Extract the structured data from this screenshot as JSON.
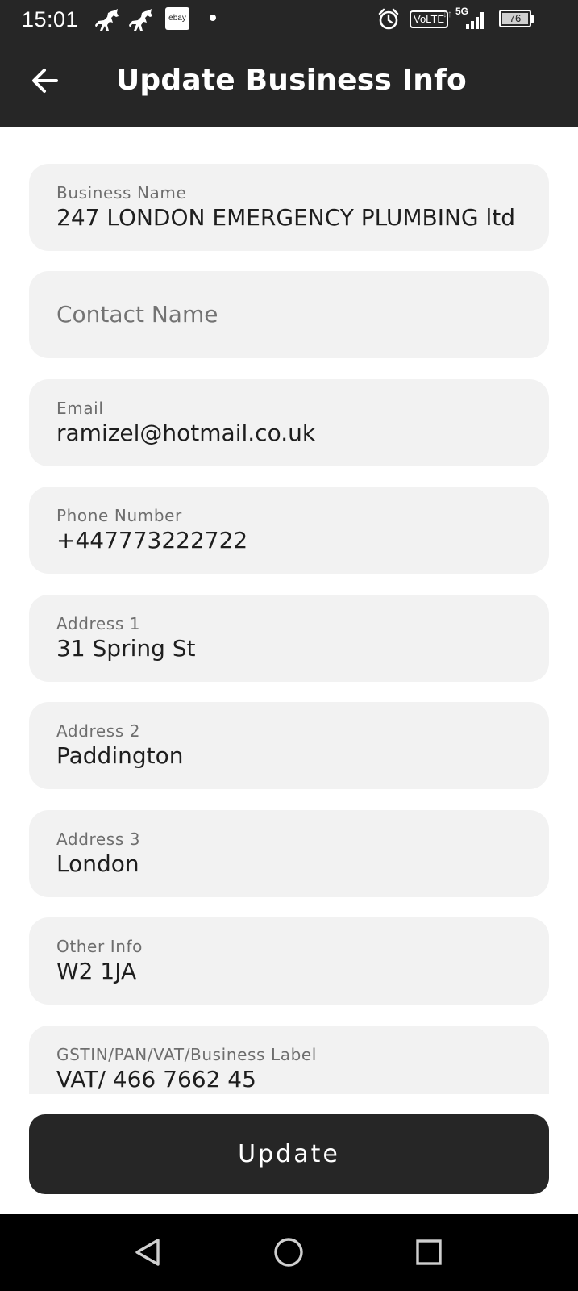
{
  "status_bar": {
    "time": "15:01",
    "ebay_label": "ebay",
    "volte": "VoLTE",
    "network_arrows": "↓↑",
    "network": "5G",
    "battery": "76",
    "icons": [
      "horse-icon",
      "horse-icon",
      "ebay-icon",
      "dot-icon",
      "alarm-icon",
      "signal-icon",
      "battery-icon"
    ]
  },
  "app_bar": {
    "title": "Update Business Info",
    "back_icon": "arrow-left-icon"
  },
  "fields": [
    {
      "label": "Business Name",
      "value": "247 LONDON EMERGENCY PLUMBING ltd"
    },
    {
      "placeholder": "Contact Name"
    },
    {
      "label": "Email",
      "value": "ramizel@hotmail.co.uk"
    },
    {
      "label": "Phone Number",
      "value": "+447773222722"
    },
    {
      "label": "Address 1",
      "value": "31 Spring St"
    },
    {
      "label": "Address 2",
      "value": "Paddington"
    },
    {
      "label": "Address 3",
      "value": "London"
    },
    {
      "label": "Other Info",
      "value": "W2 1JA"
    },
    {
      "label": "GSTIN/PAN/VAT/Business Label",
      "value": "VAT/ 466 7662 45"
    }
  ],
  "update_button": {
    "label": "Update"
  },
  "nav_bar": {
    "icons": [
      "back-triangle-icon",
      "home-circle-icon",
      "recents-square-icon"
    ]
  },
  "colors": {
    "app_bar": "#262626",
    "field_background": "#f2f2f2",
    "button": "#262626",
    "nav_bar": "#000000"
  }
}
